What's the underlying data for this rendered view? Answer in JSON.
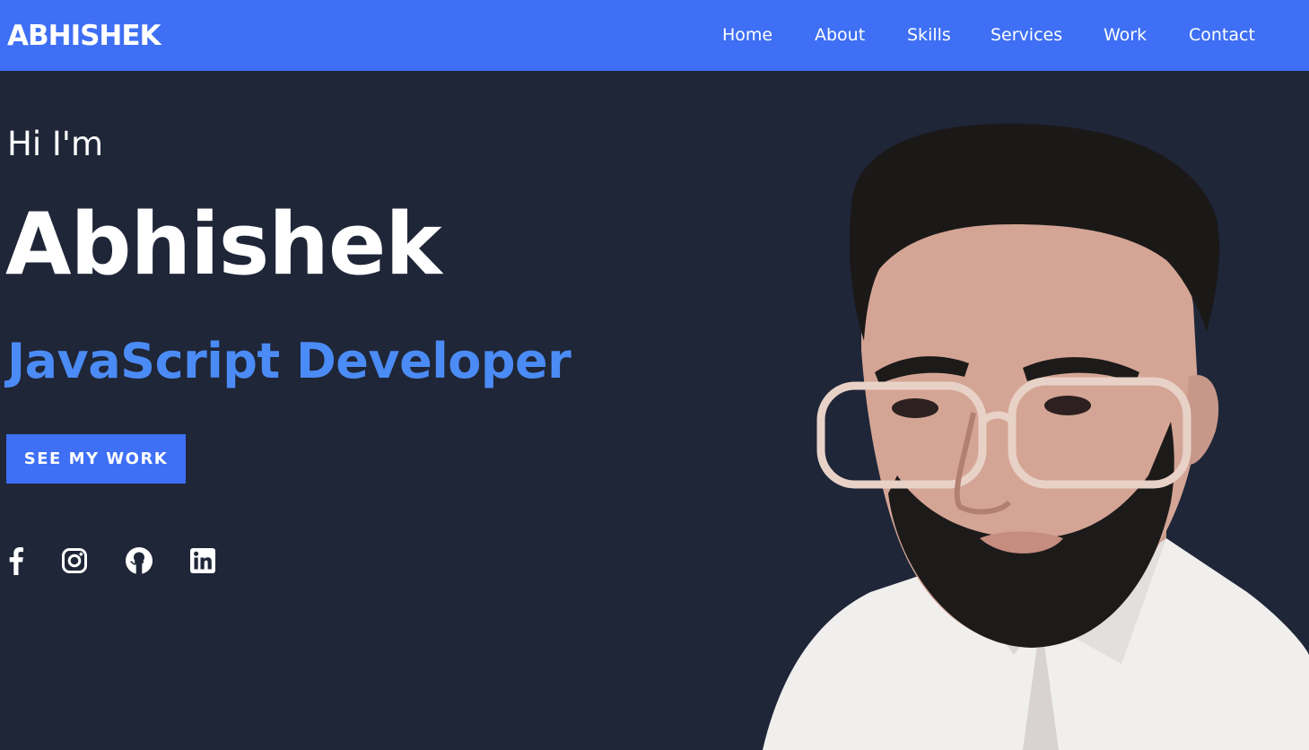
{
  "header": {
    "logo": "ABHISHEK",
    "nav": [
      {
        "label": "Home"
      },
      {
        "label": "About"
      },
      {
        "label": "Skills"
      },
      {
        "label": "Services"
      },
      {
        "label": "Work"
      },
      {
        "label": "Contact"
      }
    ]
  },
  "hero": {
    "greeting": "Hi I'm",
    "name": "Abhishek",
    "role": "JavaScript Developer",
    "cta_label": "SEE MY WORK",
    "socials": [
      {
        "icon": "facebook-icon"
      },
      {
        "icon": "instagram-icon"
      },
      {
        "icon": "github-icon"
      },
      {
        "icon": "linkedin-icon"
      }
    ]
  },
  "colors": {
    "header_bg": "#3e6ff4",
    "page_bg": "#1f2638",
    "accent_text": "#4b8bf5",
    "button_bg": "#3e6ff4",
    "text": "#ffffff"
  }
}
